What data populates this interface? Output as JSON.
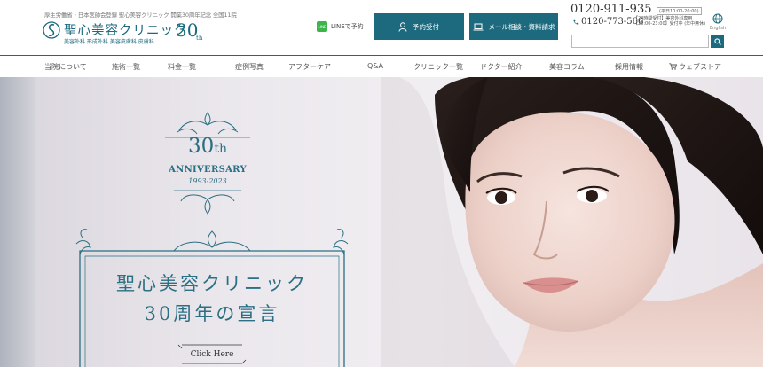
{
  "header": {
    "tagline": "厚生労働省・日本医師会登録 聖心美容クリニック 開業30周年記念 全国11院",
    "logo": {
      "name": "聖心美容クリニック",
      "anniversary_number": "30",
      "anniversary_suffix": "th",
      "subtitle": "美容外科 形成外科 美容皮膚科 皮膚科"
    },
    "line_button": "LINEで予約",
    "reserve_button": "予約受付",
    "consult_button": "メール相談・資料請求",
    "phone1": "0120-911-935",
    "phone1_note": "(平日10:00-20:00)",
    "phone2": "0120-773-566",
    "phone2_note_line1": "【24時間受付】美容外科専用",
    "phone2_note_line2": "【20:00-23:00】受付中 (年中無休)",
    "lang_label": "English",
    "search_placeholder": ""
  },
  "nav": {
    "items": [
      "当院について",
      "施術一覧",
      "料金一覧",
      "症例写真",
      "アフターケア",
      "Q&A",
      "クリニック一覧",
      "ドクター紹介",
      "美容コラム",
      "採用情報",
      "ウェブストア"
    ]
  },
  "hero": {
    "emblem": {
      "number": "30",
      "suffix": "th",
      "anniversary": "ANNIVERSARY",
      "years": "1993-2023"
    },
    "declaration_line1": "聖心美容クリニック",
    "declaration_line2": "30周年の宣言",
    "cta": "Click Here"
  },
  "colors": {
    "brand": "#1d6a7f",
    "line_green": "#3bb54a"
  }
}
